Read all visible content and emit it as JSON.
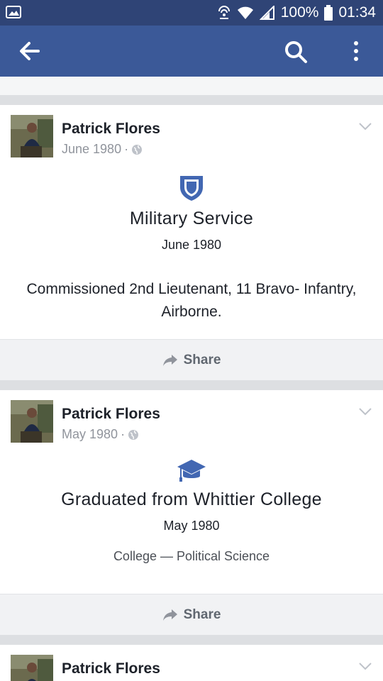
{
  "status_bar": {
    "icons": [
      "image-icon",
      "hotspot-icon",
      "wifi-icon",
      "signal-icon",
      "battery-icon"
    ],
    "battery": "100%",
    "time": "01:34"
  },
  "app_bar": {
    "color": "#3b5998",
    "icons": [
      "back-arrow-icon",
      "search-icon",
      "more-vert-icon"
    ]
  },
  "posts": [
    {
      "author": "Patrick Flores",
      "date": "June 1980",
      "separator": "·",
      "privacy_icon": "globe-icon",
      "event_icon": "shield-icon",
      "event_title": "Military Service",
      "event_date": "June 1980",
      "event_body": "Commissioned 2nd Lieutenant, 11 Bravo- Infantry, Airborne.",
      "share_label": "Share"
    },
    {
      "author": "Patrick Flores",
      "date": "May 1980",
      "separator": "·",
      "privacy_icon": "globe-icon",
      "event_icon": "graduation-cap-icon",
      "event_title": "Graduated from Whittier College",
      "event_date": "May 1980",
      "event_body": "College — Political Science",
      "share_label": "Share"
    },
    {
      "author": "Patrick Flores"
    }
  ]
}
